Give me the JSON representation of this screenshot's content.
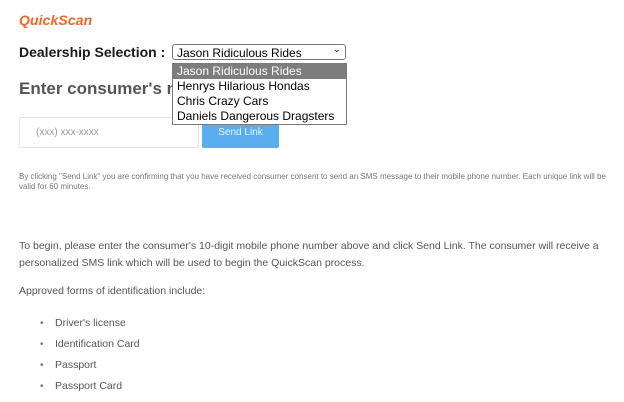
{
  "app": {
    "logo": "QuickScan"
  },
  "dealership": {
    "label": "Dealership Selection :",
    "selected": "Jason Ridiculous Rides",
    "options": [
      "Jason Ridiculous Rides",
      "Henrys Hilarious Hondas",
      "Chris Crazy Cars",
      "Daniels Dangerous Dragsters"
    ]
  },
  "form": {
    "heading": "Enter consumer's m",
    "phone_placeholder": "(xxx) xxx-xxxx",
    "send_label": "Send Link"
  },
  "disclaimer": "By clicking \"Send Link\" you are confirming that you have received consumer consent to send an SMS message to their mobile phone number. Each unique link will be valid for 60 minutes.",
  "instructions": {
    "intro": "To begin, please enter the consumer's 10-digit mobile phone number above and click Send Link. The consumer will receive a personalized SMS link which will be used to begin the QuickScan process.",
    "approved_heading": "Approved forms of identification include:",
    "id_types": [
      "Driver's license",
      "Identification Card",
      "Passport",
      "Passport Card"
    ]
  },
  "colors": {
    "brand": "#f26522",
    "button": "#5aaef0",
    "dropdown_highlight": "#7d7d7d"
  }
}
